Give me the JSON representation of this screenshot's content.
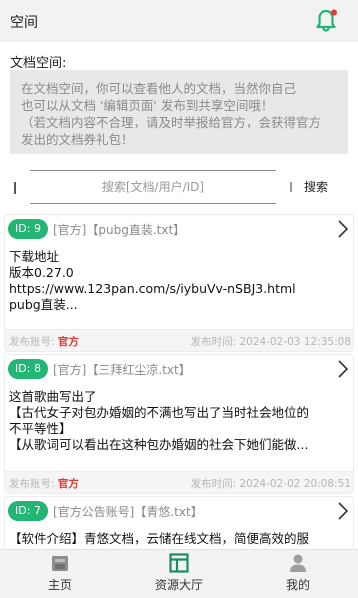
{
  "topbar": {
    "title": "空间",
    "bell_icon": "bell-icon",
    "accent": "#22b573"
  },
  "section": {
    "label": "文档空间:"
  },
  "notice": {
    "line1": "在文档空间，你可以查看他人的文档，当然你自己",
    "line2": "也可以从文档 '编辑页面' 发布到共享空间哦！",
    "line3": "（若文档内容不合理，请及时举报给官方，会获得官方",
    "line4": "发出的文档券礼包！"
  },
  "search": {
    "placeholder": "搜索[文档/用户/ID]",
    "button_label": "搜索"
  },
  "cards": [
    {
      "id": "ID: 9",
      "head": "[官方]【pubg直装.txt】",
      "lines": [
        "下载地址",
        "版本0.27.0",
        "https://www.123pan.com/s/iybuVv-nSBJ3.html",
        "pubg直装..."
      ],
      "account_label": "发布账号: ",
      "account": "官方",
      "time": "发布时间: 2024-02-03 12:35:08"
    },
    {
      "id": "ID: 8",
      "head": "[官方]【三拜红尘凉.txt】",
      "lines": [
        "这首歌曲写出了",
        "【古代女子对包办婚姻的不满也写出了当时社会地位的",
        "不平等性】",
        "【从歌词可以看出在这种包办婚姻的社会下她们能做..."
      ],
      "account_label": "发布账号: ",
      "account": "官方",
      "time": "发布时间: 2024-02-02 20:08:51"
    },
    {
      "id": "ID: 7",
      "head": "[官方公告账号]【青悠.txt】",
      "lines": [
        "【软件介绍】青悠文档，云储在线文档，简便高效的服"
      ],
      "account_label": "",
      "account": "",
      "time": ""
    }
  ],
  "bottom_nav": [
    {
      "label": "主页",
      "icon": "home-icon"
    },
    {
      "label": "资源大厅",
      "icon": "window-icon"
    },
    {
      "label": "我的",
      "icon": "user-icon"
    }
  ]
}
